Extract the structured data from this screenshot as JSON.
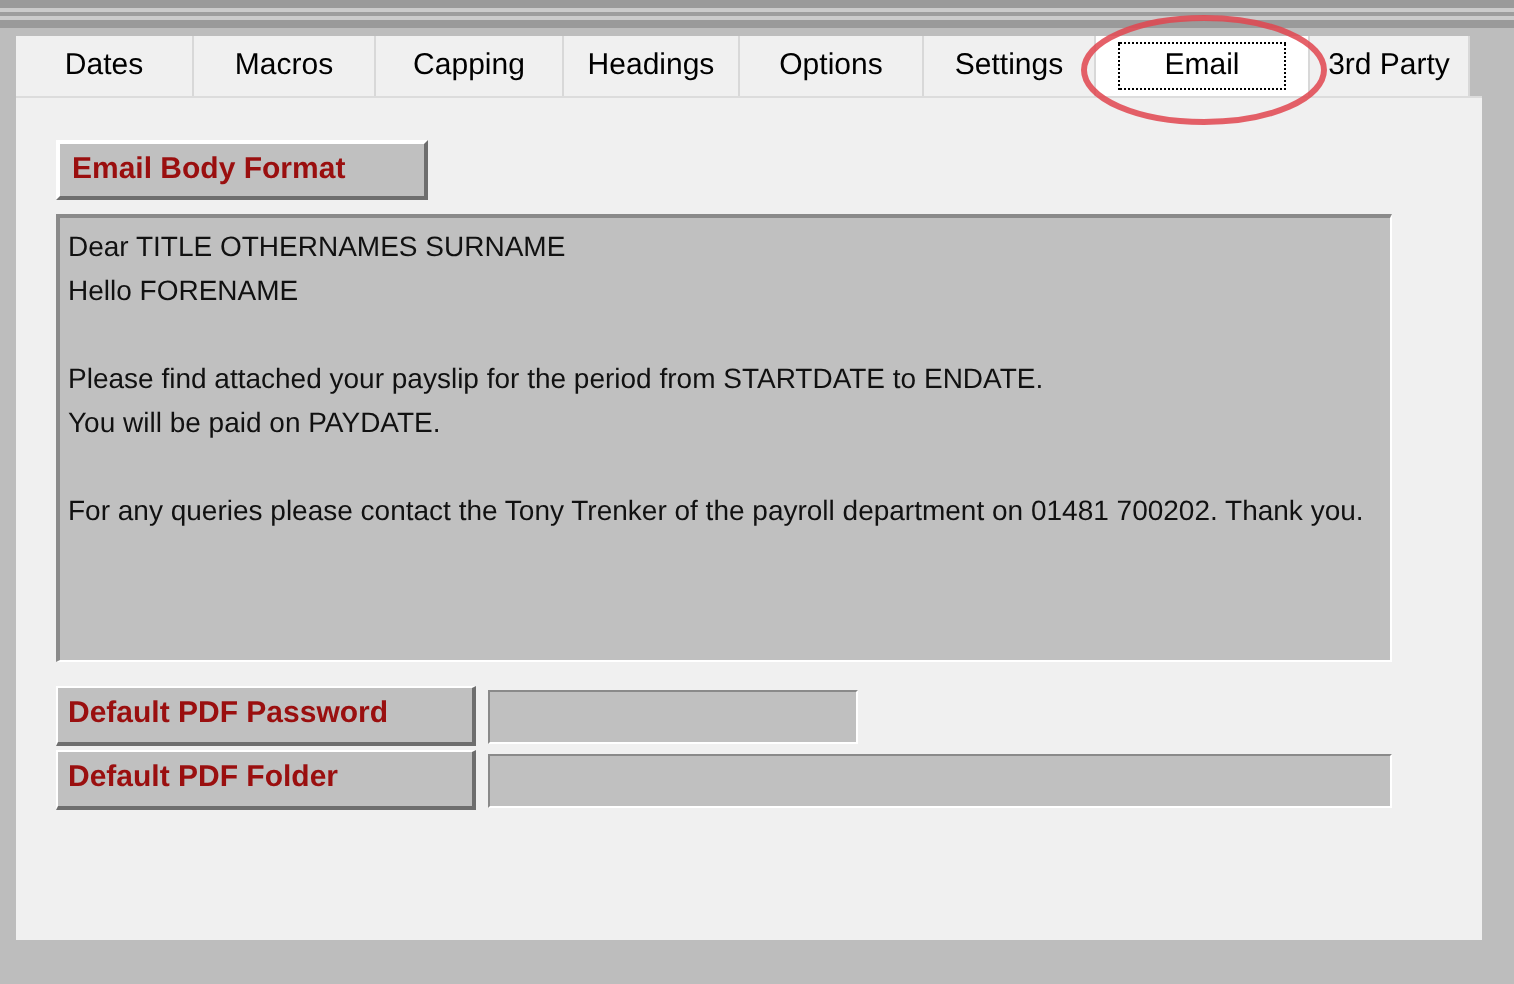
{
  "tabs": [
    {
      "label": "Dates",
      "selected": false
    },
    {
      "label": "Macros",
      "selected": false
    },
    {
      "label": "Capping",
      "selected": false
    },
    {
      "label": "Headings",
      "selected": false
    },
    {
      "label": "Options",
      "selected": false
    },
    {
      "label": "Settings",
      "selected": false
    },
    {
      "label": "Email",
      "selected": true,
      "circled": true
    },
    {
      "label": "3rd Party",
      "selected": false
    }
  ],
  "email_body": {
    "button": "Email Body Format",
    "paragraphs": [
      [
        "Dear TITLE OTHERNAMES SURNAME",
        "Hello FORENAME"
      ],
      [
        "Please find attached your payslip for the period from STARTDATE to ENDATE.",
        "You will be paid on PAYDATE."
      ],
      [
        "For any queries please contact the Tony Trenker of the payroll department on 01481 700202.  Thank you."
      ]
    ]
  },
  "fields": [
    {
      "label": "Default PDF Password",
      "wide": false
    },
    {
      "label": "Default PDF Folder",
      "wide": true
    }
  ]
}
